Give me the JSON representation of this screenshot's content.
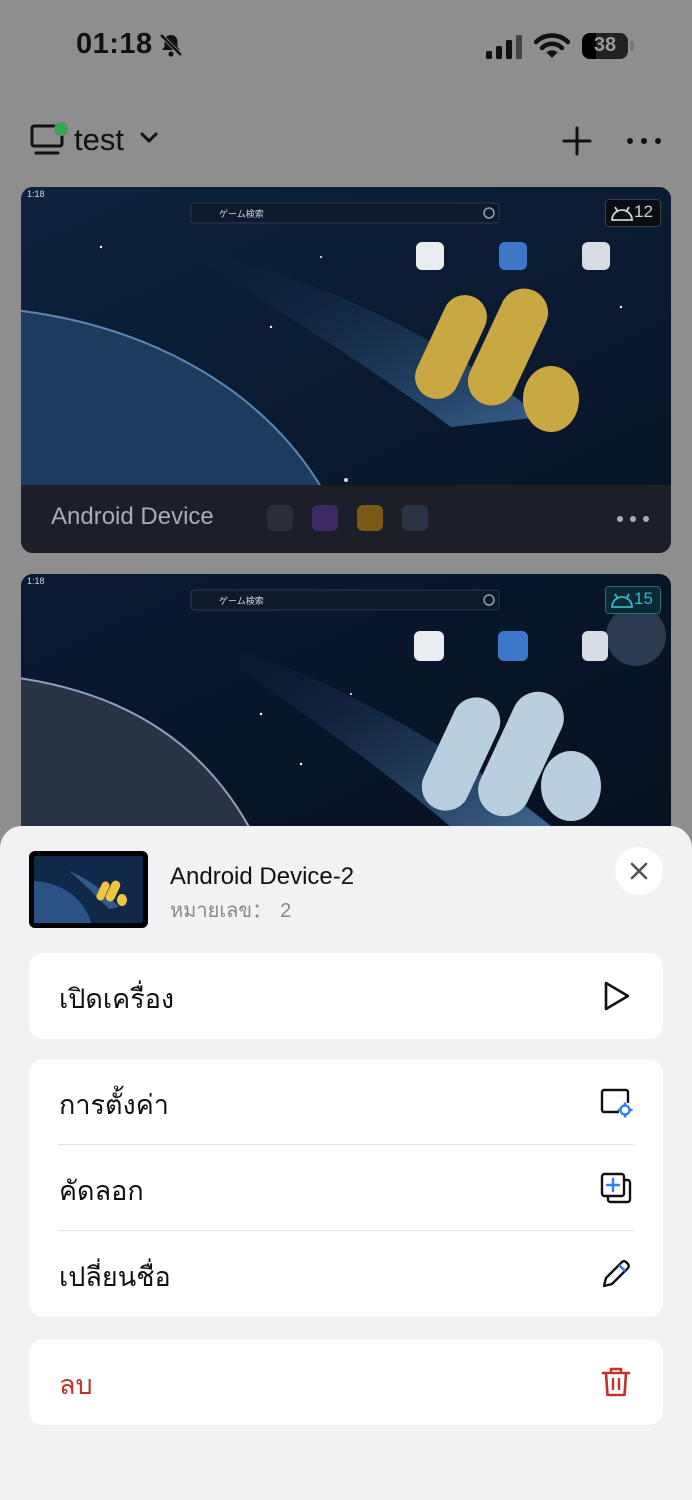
{
  "status_bar": {
    "time": "01:18",
    "battery": "38"
  },
  "header": {
    "group_name": "test"
  },
  "devices": [
    {
      "name": "Android Device",
      "os_version": "12",
      "badge_color": "#c9d1da",
      "mini_time": "1:18",
      "search_text": "ゲーム検索"
    },
    {
      "os_version": "15",
      "badge_color": "#3bb5c7",
      "mini_time": "1:18",
      "search_text": "ゲーム検索"
    }
  ],
  "sheet": {
    "device_title": "Android Device-2",
    "id_label": "หมายเลข：",
    "id_value": "2",
    "actions": {
      "power_on": "เปิดเครื่อง",
      "settings": "การตั้งค่า",
      "copy": "คัดลอก",
      "rename": "เปลี่ยนชื่อ",
      "delete": "ลบ"
    }
  },
  "colors": {
    "online": "#22b14c",
    "danger": "#c0322a",
    "accent": "#2e7cf6"
  }
}
